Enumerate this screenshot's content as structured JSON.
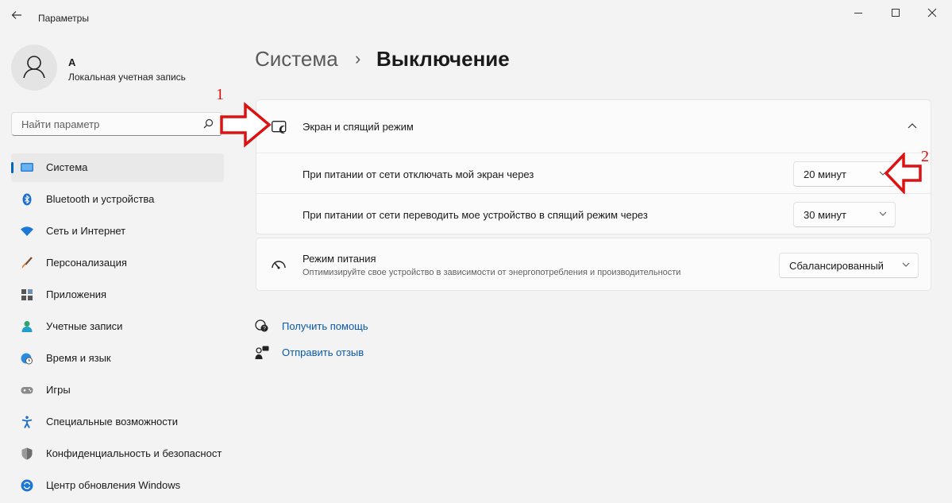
{
  "window": {
    "title": "Параметры",
    "back_icon": "arrow-left-icon"
  },
  "profile": {
    "name": "A",
    "account_type": "Локальная учетная запись"
  },
  "search": {
    "placeholder": "Найти параметр"
  },
  "sidebar": {
    "items": [
      {
        "label": "Система",
        "icon": "monitor-icon",
        "active": true
      },
      {
        "label": "Bluetooth и устройства",
        "icon": "bluetooth-icon"
      },
      {
        "label": "Сеть и Интернет",
        "icon": "wifi-icon"
      },
      {
        "label": "Персонализация",
        "icon": "brush-icon"
      },
      {
        "label": "Приложения",
        "icon": "apps-icon"
      },
      {
        "label": "Учетные записи",
        "icon": "person-icon"
      },
      {
        "label": "Время и язык",
        "icon": "globe-clock-icon"
      },
      {
        "label": "Игры",
        "icon": "gamepad-icon"
      },
      {
        "label": "Специальные возможности",
        "icon": "accessibility-icon"
      },
      {
        "label": "Конфиденциальность и безопасность",
        "icon": "shield-icon"
      },
      {
        "label": "Центр обновления Windows",
        "icon": "update-icon"
      }
    ]
  },
  "breadcrumb": {
    "parent": "Система",
    "separator": "›",
    "current": "Выключение"
  },
  "screen_sleep": {
    "title": "Экран и спящий режим",
    "rows": [
      {
        "label": "При питании от сети отключать мой экран через",
        "value": "20 минут"
      },
      {
        "label": "При питании от сети переводить мое устройство в спящий режим через",
        "value": "30 минут"
      }
    ]
  },
  "power_mode": {
    "title": "Режим питания",
    "description": "Оптимизируйте свое устройство в зависимости от энергопотребления и производительности",
    "value": "Сбалансированный"
  },
  "links": {
    "help": "Получить помощь",
    "feedback": "Отправить отзыв"
  },
  "annotations": {
    "first": "1",
    "second": "2"
  },
  "colors": {
    "accent": "#0067c0",
    "annotation": "#dd1111",
    "background": "#f3f3f3"
  }
}
